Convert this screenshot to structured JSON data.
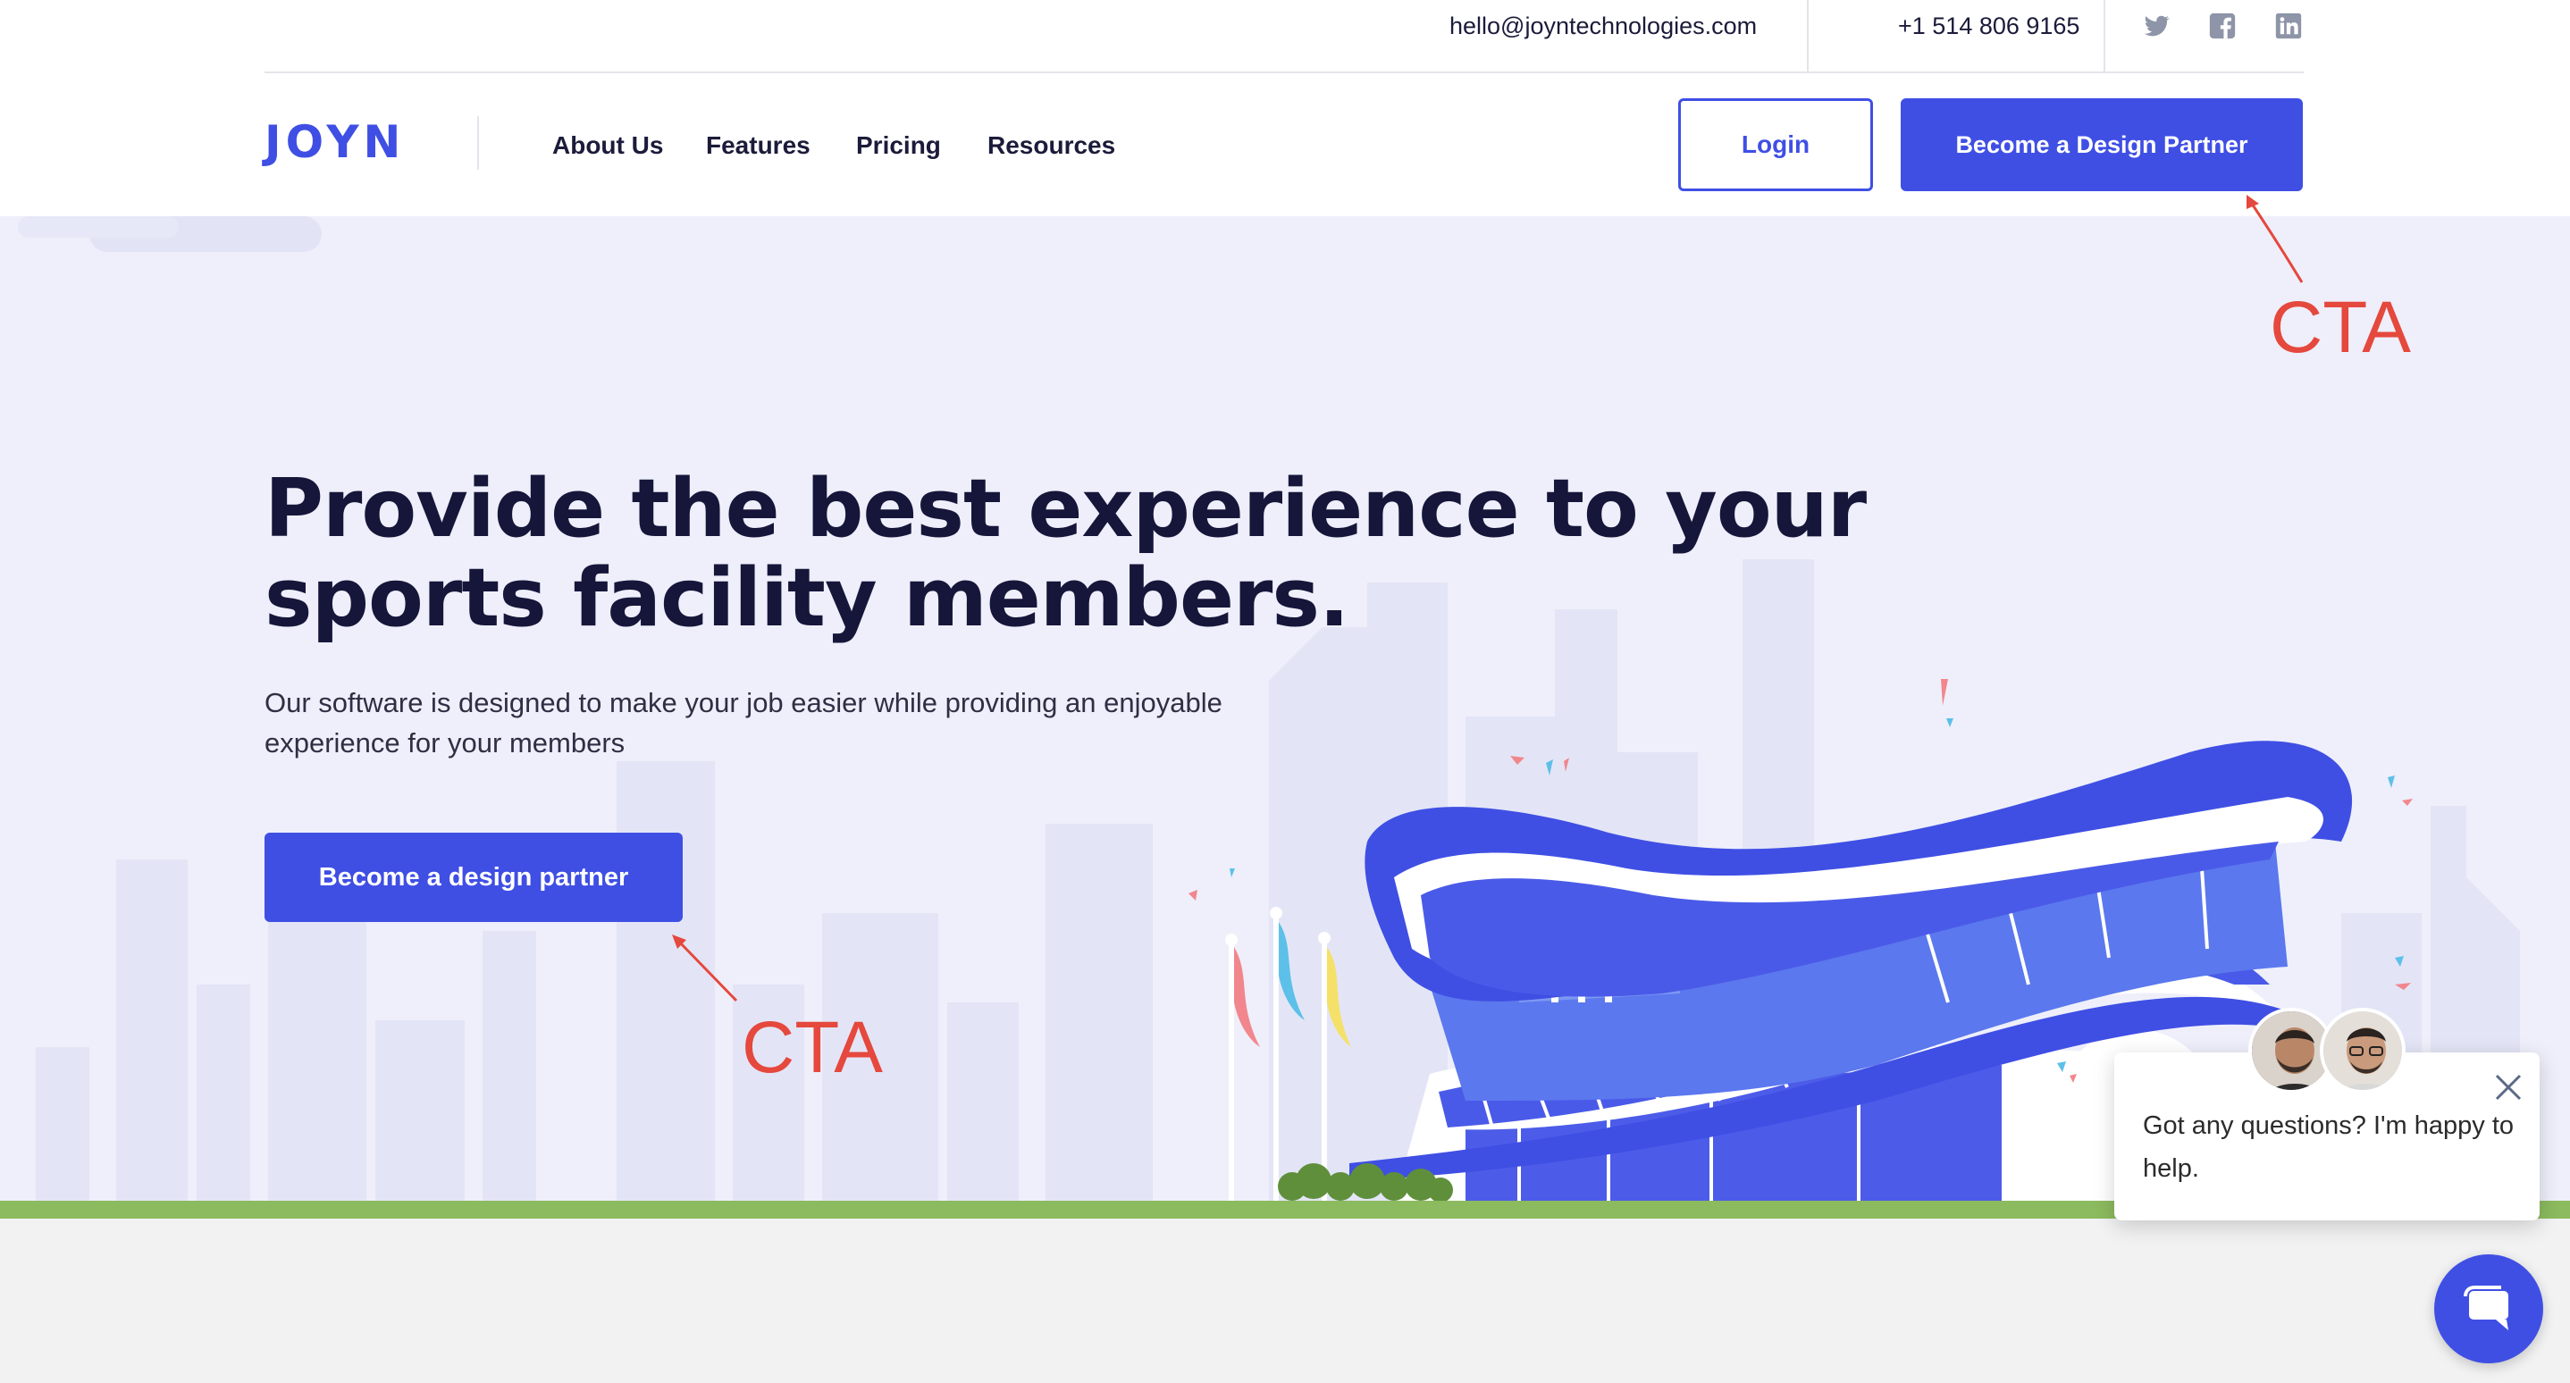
{
  "topbar": {
    "email": "hello@joyntechnologies.com",
    "phone": "+1 514 806 9165",
    "social_icons": [
      "twitter-icon",
      "facebook-icon",
      "linkedin-icon"
    ]
  },
  "header": {
    "logo": "JOYN",
    "nav": [
      "About Us",
      "Features",
      "Pricing",
      "Resources"
    ],
    "login_label": "Login",
    "partner_label": "Become a Design Partner"
  },
  "hero": {
    "title_line1": "Provide the best experience to your",
    "title_line2": "sports facility members.",
    "subtitle_line1": "Our software is designed to make your job easier while providing an enjoyable",
    "subtitle_line2": "experience for your members",
    "cta_label": "Become a design partner"
  },
  "annotations": {
    "header_cta": "CTA",
    "hero_cta": "CTA"
  },
  "chat": {
    "message": "Got any questions? I'm happy to help."
  },
  "colors": {
    "brand": "#3f4fe4",
    "hero_bg": "#eeeffa",
    "annotation": "#e5483d",
    "grass": "#8cba5e"
  }
}
